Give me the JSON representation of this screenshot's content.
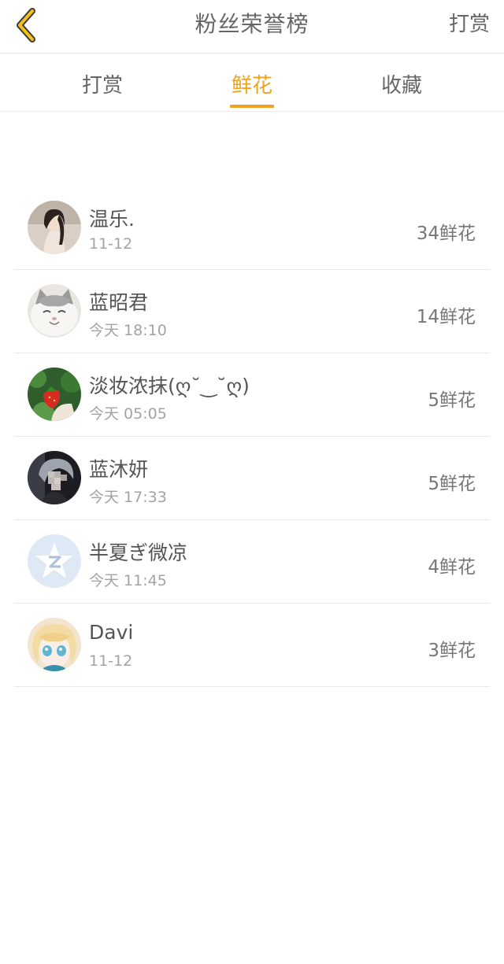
{
  "header": {
    "back_icon": "chevron-left-icon",
    "title": "粉丝荣誉榜",
    "action_label": "打赏",
    "accent_color": "#f0a21e"
  },
  "tabs": [
    {
      "label": "打赏",
      "active": false
    },
    {
      "label": "鲜花",
      "active": true
    },
    {
      "label": "收藏",
      "active": false
    }
  ],
  "fans": [
    {
      "name": "温乐.",
      "time": "11-12",
      "amount": "34鲜花"
    },
    {
      "name": "蓝昭君",
      "time": "今天 18:10",
      "amount": "14鲜花"
    },
    {
      "name": "淡妆浓抹(ღ˘‿˘ღ)",
      "time": "今天 05:05",
      "amount": "5鲜花"
    },
    {
      "name": "蓝沐妍",
      "time": "今天 17:33",
      "amount": "5鲜花"
    },
    {
      "name": "半夏ぎ微凉",
      "time": "今天 11:45",
      "amount": "4鲜花"
    },
    {
      "name": "Davi",
      "time": "11-12",
      "amount": "3鲜花"
    }
  ]
}
